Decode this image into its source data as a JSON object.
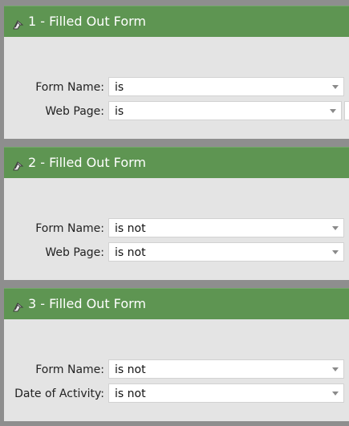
{
  "cards": [
    {
      "title": "1 - Filled Out Form",
      "icon": "flow-arrow-icon",
      "rows": [
        {
          "label": "Form Name:",
          "operator": "is"
        },
        {
          "label": "Web Page:",
          "operator": "is"
        }
      ]
    },
    {
      "title": "2 - Filled Out Form",
      "icon": "flow-arrow-icon",
      "rows": [
        {
          "label": "Form Name:",
          "operator": "is not"
        },
        {
          "label": "Web Page:",
          "operator": "is not"
        }
      ]
    },
    {
      "title": "3 - Filled Out Form",
      "icon": "flow-arrow-icon",
      "rows": [
        {
          "label": "Form Name:",
          "operator": "is not"
        },
        {
          "label": "Date of Activity:",
          "operator": "is not"
        }
      ]
    }
  ],
  "colors": {
    "header_green": "#5e9552",
    "card_background": "#e4e4e4",
    "page_background": "#8e8e8e"
  }
}
